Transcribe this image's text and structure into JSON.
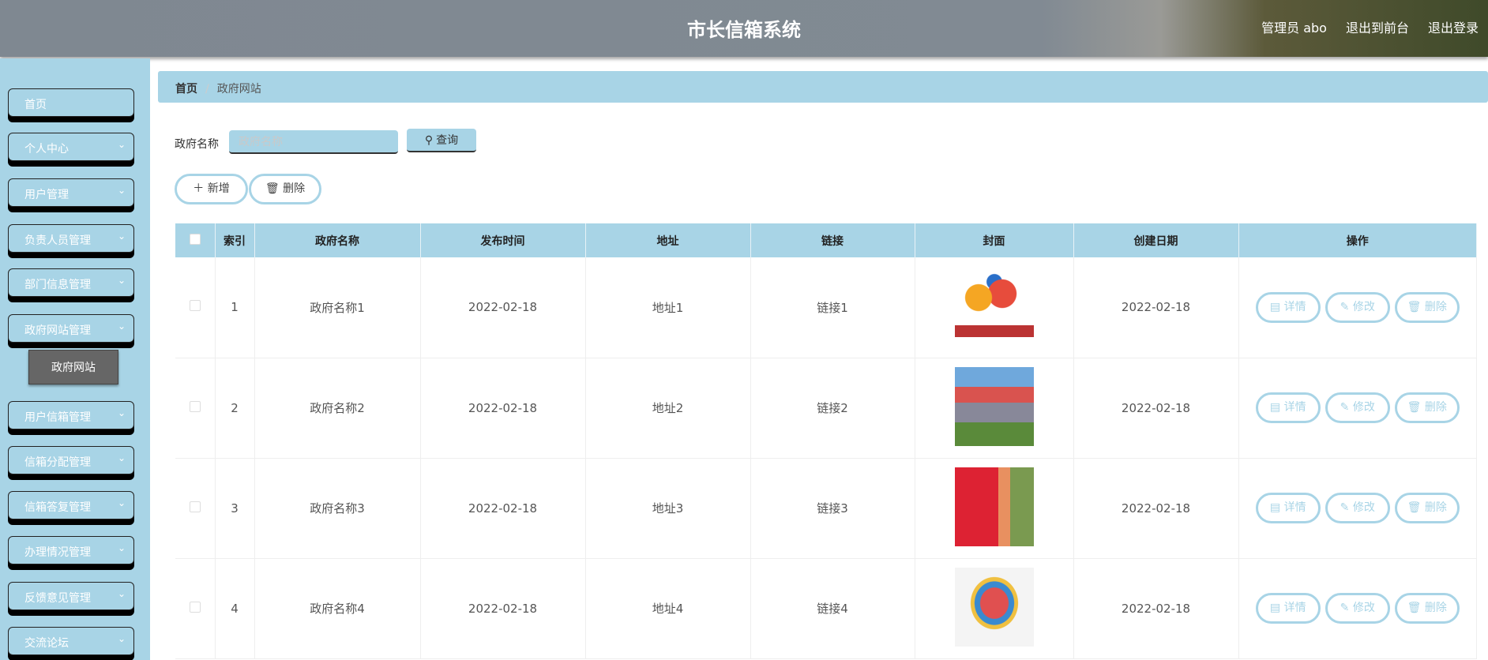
{
  "header": {
    "title": "市长信箱系统",
    "user": "管理员 abo",
    "to_front": "退出到前台",
    "logout": "退出登录"
  },
  "sidebar": {
    "items": [
      {
        "label": "首页",
        "chevron": false
      },
      {
        "label": "个人中心",
        "chevron": true
      },
      {
        "label": "用户管理",
        "chevron": true
      },
      {
        "label": "负责人员管理",
        "chevron": true
      },
      {
        "label": "部门信息管理",
        "chevron": true
      },
      {
        "label": "政府网站管理",
        "chevron": true
      },
      {
        "label": "用户信箱管理",
        "chevron": true
      },
      {
        "label": "信箱分配管理",
        "chevron": true
      },
      {
        "label": "信箱答复管理",
        "chevron": true
      },
      {
        "label": "办理情况管理",
        "chevron": true
      },
      {
        "label": "反馈意见管理",
        "chevron": true
      },
      {
        "label": "交流论坛",
        "chevron": true
      }
    ],
    "sub_item": "政府网站"
  },
  "breadcrumb": {
    "home": "首页",
    "current": "政府网站"
  },
  "search": {
    "label": "政府名称",
    "placeholder": "政府名称",
    "value": "",
    "button": "查询"
  },
  "actions": {
    "add": "新增",
    "delete": "删除"
  },
  "table": {
    "headers": [
      "索引",
      "政府名称",
      "发布时间",
      "地址",
      "链接",
      "封面",
      "创建日期",
      "操作"
    ],
    "rows": [
      {
        "index": "1",
        "name": "政府名称1",
        "publish": "2022-02-18",
        "address": "地址1",
        "link": "链接1",
        "cover": "heart-people-logo",
        "created": "2022-02-18"
      },
      {
        "index": "2",
        "name": "政府名称2",
        "publish": "2022-02-18",
        "address": "地址2",
        "link": "链接2",
        "cover": "event-photo",
        "created": "2022-02-18"
      },
      {
        "index": "3",
        "name": "政府名称3",
        "publish": "2022-02-18",
        "address": "地址3",
        "link": "链接3",
        "cover": "red-banner-photo",
        "created": "2022-02-18"
      },
      {
        "index": "4",
        "name": "政府名称4",
        "publish": "2022-02-18",
        "address": "地址4",
        "link": "链接4",
        "cover": "book-heart-logo",
        "created": "2022-02-18"
      }
    ],
    "row_actions": {
      "detail": "详情",
      "edit": "修改",
      "delete": "删除"
    }
  },
  "colors": {
    "accent": "#a8d4e6",
    "header": "#818a93"
  }
}
